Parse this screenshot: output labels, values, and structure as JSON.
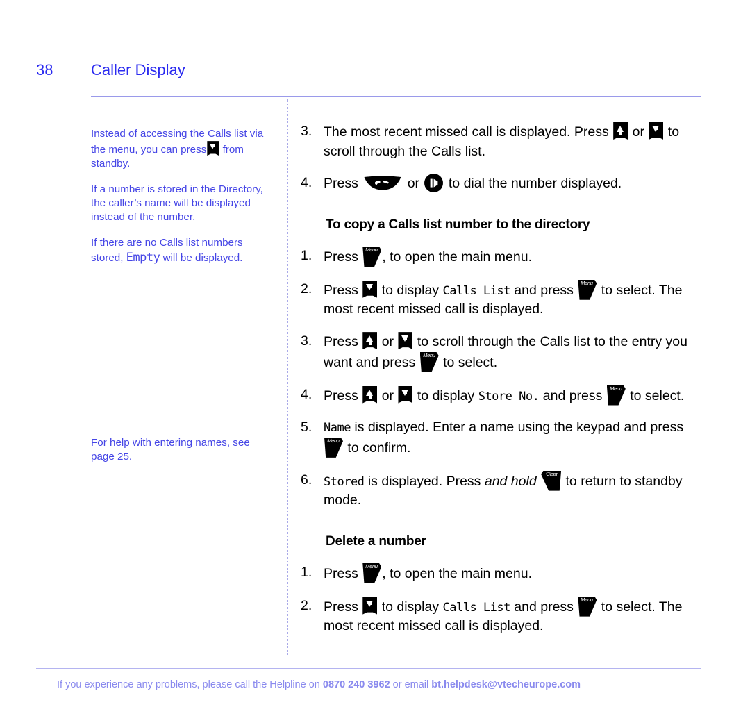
{
  "header": {
    "page_number": "38",
    "chapter_title": "Caller Display",
    "rule_color": "#9a9aea"
  },
  "colors": {
    "accent_blue": "#2b2bf0",
    "note_blue": "#4646e6",
    "footer_blue": "#8a8aee",
    "rule_lavender": "#9a9aea"
  },
  "sidebar": {
    "notes": [
      {
        "id": "note-standby-shortcut",
        "pre": "Instead of accessing the Calls list via the menu, you can press",
        "icon": "down-arrow-key-icon",
        "post": "from standby."
      },
      {
        "id": "note-directory-name",
        "text": "If a number is stored in the Directory, the caller’s name will be displayed instead of the number."
      },
      {
        "id": "note-empty-list",
        "pre": "If there are no Calls list numbers stored,",
        "lcd": "Empty",
        "post": "will be displayed."
      }
    ],
    "lower_note": {
      "id": "note-entering-names",
      "text": "For help with entering names, see page 25."
    }
  },
  "main": {
    "intro_steps": [
      {
        "num": "3.",
        "a": "The most recent missed call is displayed. Press",
        "icon1": "up-arrow-key-icon",
        "or": "or",
        "icon2": "down-arrow-key-icon",
        "b": "to scroll through the Calls list."
      },
      {
        "num": "4.",
        "a": "Press",
        "icon1": "talk-key-icon",
        "or": "or",
        "icon2": "handsfree-key-icon",
        "b": "to dial the number displayed."
      }
    ],
    "section_copy": {
      "heading": "To copy a Calls list number to the directory",
      "steps": [
        {
          "num": "1.",
          "a": "Press",
          "icon1": "menu-key-icon",
          "b": ", to open the main menu."
        },
        {
          "num": "2.",
          "a": "Press",
          "icon1": "down-arrow-key-icon",
          "b": "to display",
          "lcd": "Calls List",
          "c": "and press",
          "icon2": "menu-key-icon",
          "d": "to select. The most recent missed call is displayed."
        },
        {
          "num": "3.",
          "a": "Press",
          "icon1": "up-arrow-key-icon",
          "or": "or",
          "icon2": "down-arrow-key-icon",
          "b": "to scroll through the Calls list to the entry you want and press",
          "icon3": "menu-key-icon",
          "c": "to select."
        },
        {
          "num": "4.",
          "a": "Press",
          "icon1": "up-arrow-key-icon",
          "or": "or",
          "icon2": "down-arrow-key-icon",
          "b": "to display",
          "lcd": "Store No.",
          "c": "and press",
          "icon3": "menu-key-icon",
          "d": "to select."
        },
        {
          "num": "5.",
          "lcd": "Name",
          "a": "is displayed. Enter a name using the keypad and press",
          "icon1": "menu-key-icon",
          "b": "to confirm."
        },
        {
          "num": "6.",
          "lcd": "Stored",
          "a": "is displayed. Press",
          "emph": "and hold",
          "icon1": "clear-key-icon",
          "b": "to return to standby mode."
        }
      ]
    },
    "section_delete": {
      "heading": "Delete a number",
      "steps": [
        {
          "num": "1.",
          "a": "Press",
          "icon1": "menu-key-icon",
          "b": ", to open the main menu."
        },
        {
          "num": "2.",
          "a": "Press",
          "icon1": "down-arrow-key-icon",
          "b": "to display",
          "lcd": "Calls List",
          "c": "and press",
          "icon2": "menu-key-icon",
          "d": "to select. The most recent missed call is displayed."
        }
      ]
    }
  },
  "keys": {
    "menu_label": "Menu",
    "clear_label": "Clear"
  },
  "footer": {
    "lead": "If you experience any problems, please call the Helpline on",
    "phone": "0870 240 3962",
    "mid": "or email",
    "email": "bt.helpdesk@vtecheurope.com"
  }
}
